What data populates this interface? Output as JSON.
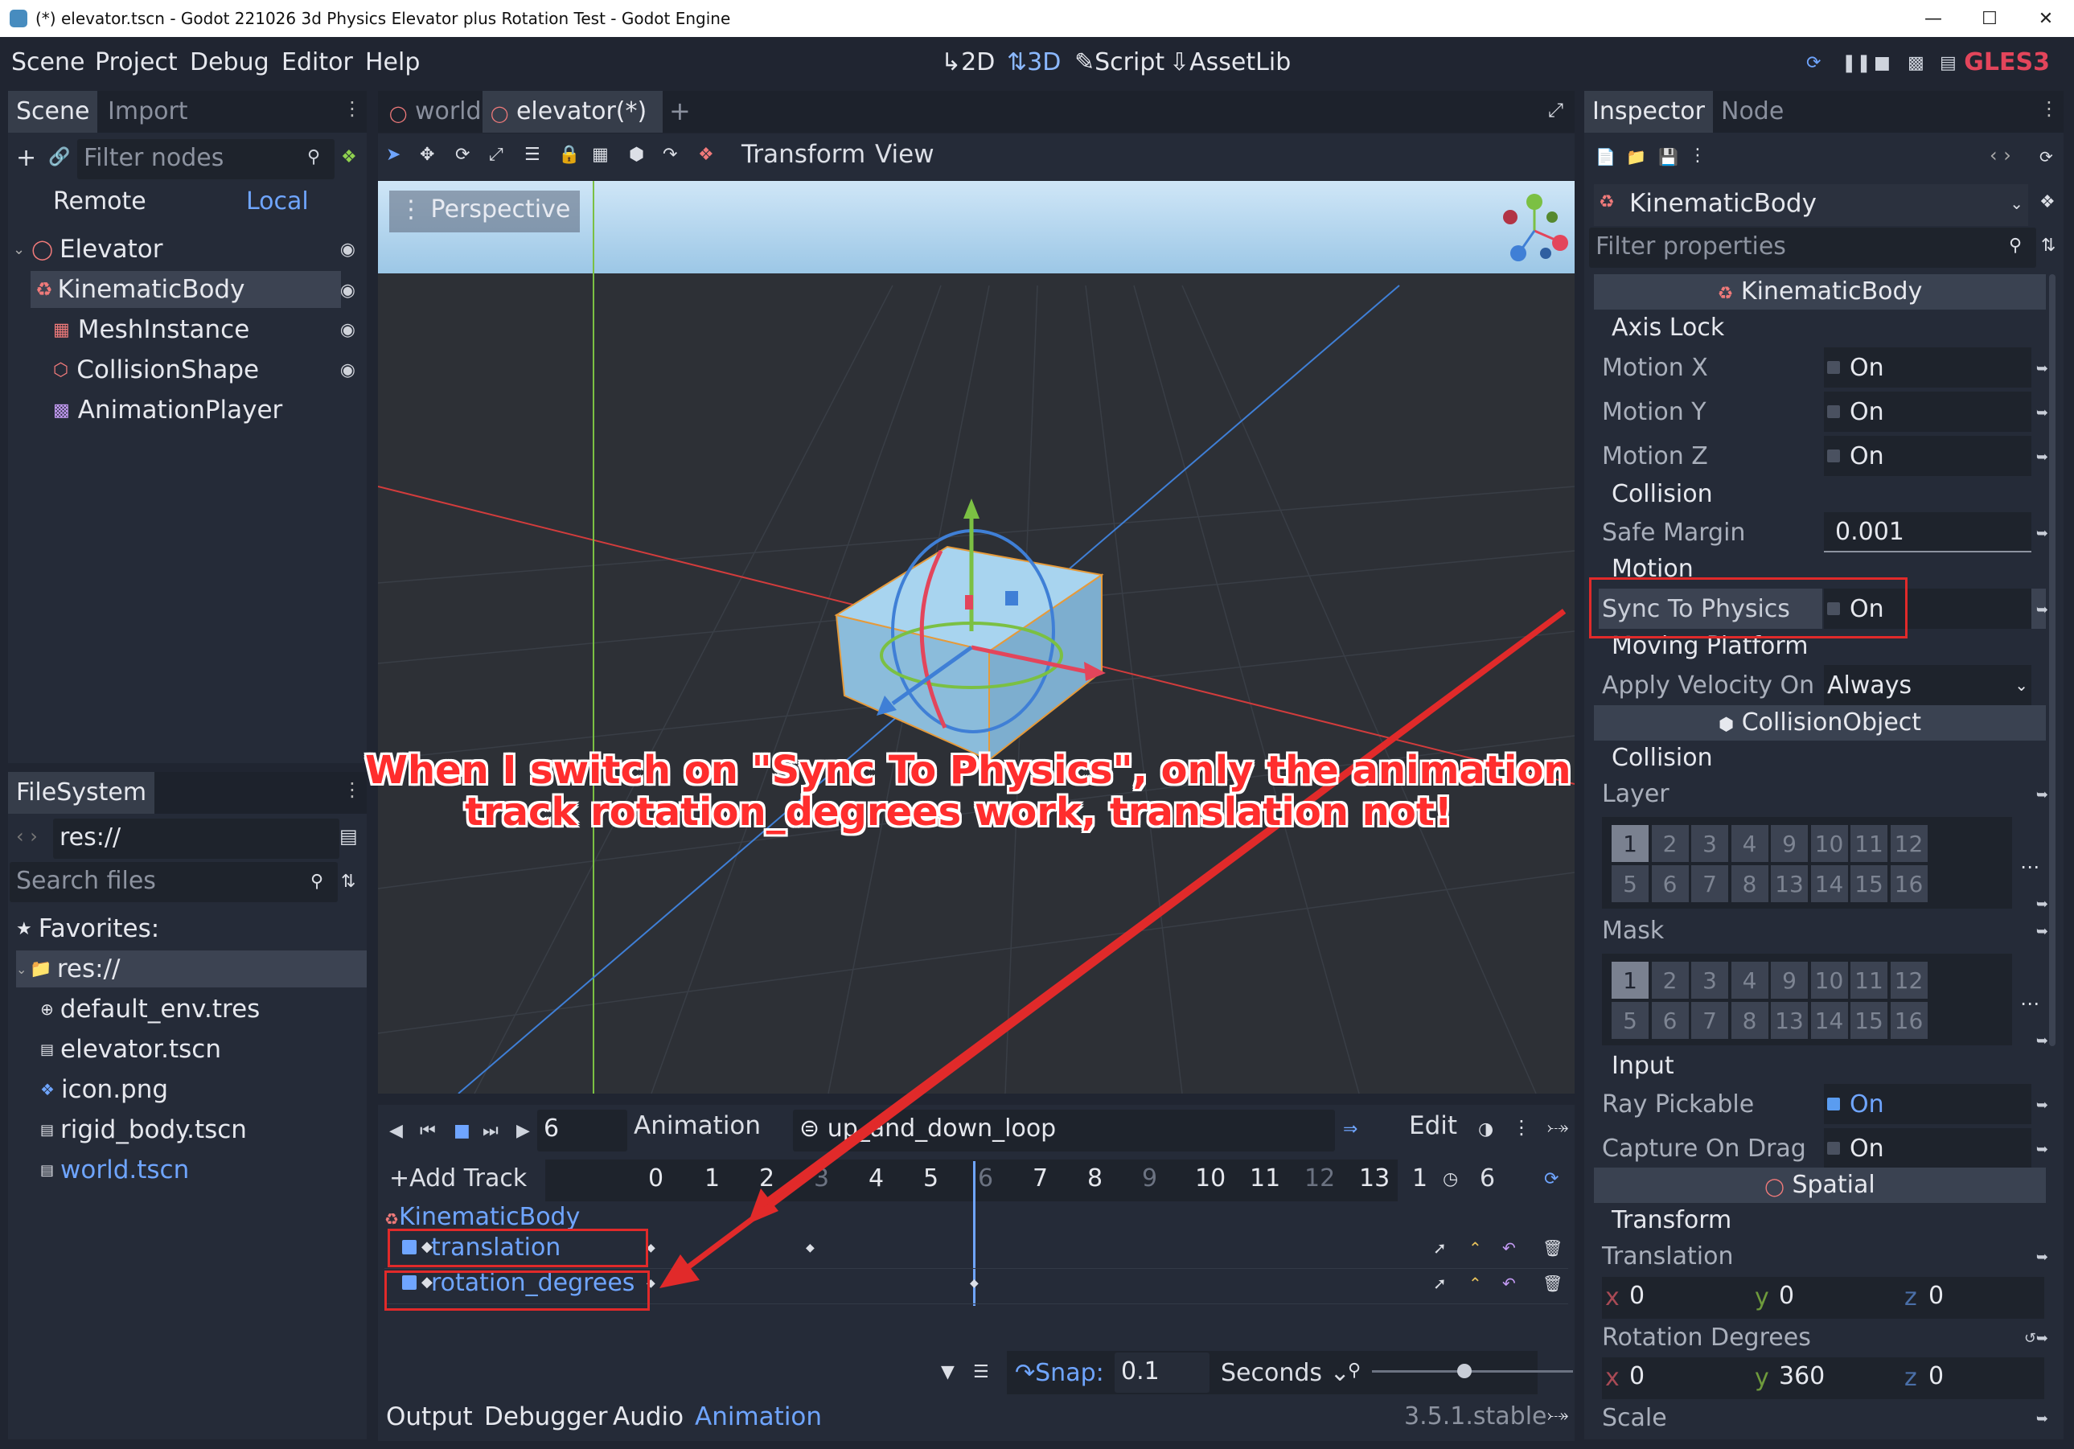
{
  "window": {
    "title": "(*) elevator.tscn - Godot 221026 3d Physics Elevator plus Rotation Test - Godot Engine"
  },
  "menu": [
    "Scene",
    "Project",
    "Debug",
    "Editor",
    "Help"
  ],
  "workspaces": [
    "2D",
    "3D",
    "Script",
    "AssetLib"
  ],
  "renderer": "GLES3",
  "scene_dock": {
    "tabs": [
      "Scene",
      "Import"
    ],
    "filter_placeholder": "Filter nodes",
    "remote": "Remote",
    "local": "Local",
    "nodes": [
      "Elevator",
      "KinematicBody",
      "MeshInstance",
      "CollisionShape",
      "AnimationPlayer"
    ]
  },
  "filesystem": {
    "tab": "FileSystem",
    "path": "res://",
    "search_placeholder": "Search files",
    "favorites": "Favorites:",
    "root": "res://",
    "files": [
      "default_env.tres",
      "elevator.tscn",
      "icon.png",
      "rigid_body.tscn",
      "world.tscn"
    ]
  },
  "editor_tabs": [
    "world",
    "elevator(*)"
  ],
  "viewport_toolbar": {
    "transform": "Transform",
    "view": "View"
  },
  "viewport": {
    "perspective": "Perspective"
  },
  "inspector": {
    "tabs": [
      "Inspector",
      "Node"
    ],
    "object": "KinematicBody",
    "filter_placeholder": "Filter properties",
    "sections": {
      "kinematic": "KinematicBody",
      "collision_object": "CollisionObject",
      "spatial": "Spatial"
    },
    "groups": {
      "axis_lock": "Axis Lock",
      "collision": "Collision",
      "motion": "Motion",
      "moving_platform": "Moving Platform",
      "collision2": "Collision",
      "input": "Input",
      "transform": "Transform"
    },
    "props": {
      "motion_x": "Motion X",
      "motion_y": "Motion Y",
      "motion_z": "Motion Z",
      "safe_margin": "Safe Margin",
      "safe_margin_val": "0.001",
      "sync_to_physics": "Sync To Physics",
      "apply_velocity": "Apply Velocity On L",
      "apply_velocity_val": "Always",
      "layer": "Layer",
      "mask": "Mask",
      "ray_pickable": "Ray Pickable",
      "capture_on_drag": "Capture On Drag",
      "translation": "Translation",
      "rotation_degrees": "Rotation Degrees",
      "scale": "Scale"
    },
    "on": "On",
    "layer_bits": [
      "1",
      "2",
      "3",
      "4",
      "9",
      "10",
      "11",
      "12",
      "5",
      "6",
      "7",
      "8",
      "13",
      "14",
      "15",
      "16"
    ],
    "translation": {
      "x": "0",
      "y": "0",
      "z": "0"
    },
    "rotation": {
      "x": "0",
      "y": "360",
      "z": "0"
    }
  },
  "animation": {
    "frame": "6",
    "animation_label": "Animation",
    "current": "up_and_down_loop",
    "edit": "Edit",
    "add_track": "Add Track",
    "timeline": [
      "0",
      "1",
      "2",
      "3",
      "4",
      "5",
      "6",
      "7",
      "8",
      "9",
      "10",
      "11",
      "12",
      "13",
      "1"
    ],
    "length": "6",
    "node": "KinematicBody",
    "tracks": [
      "translation",
      "rotation_degrees"
    ],
    "snap_label": "Snap:",
    "snap_value": "0.1",
    "snap_unit": "Seconds"
  },
  "bottom_tabs": [
    "Output",
    "Debugger",
    "Audio",
    "Animation"
  ],
  "version": "3.5.1.stable",
  "annotation": {
    "line1": "When I switch on \"Sync To Physics\", only the animation",
    "line2": "track rotation_degrees work, translation not!"
  },
  "colors": {
    "accent": "#6fa5ff",
    "annotation": "#e12a2a",
    "x_axis": "#e3455b",
    "y_axis": "#8fd14f",
    "z_axis": "#4d8ff0"
  }
}
